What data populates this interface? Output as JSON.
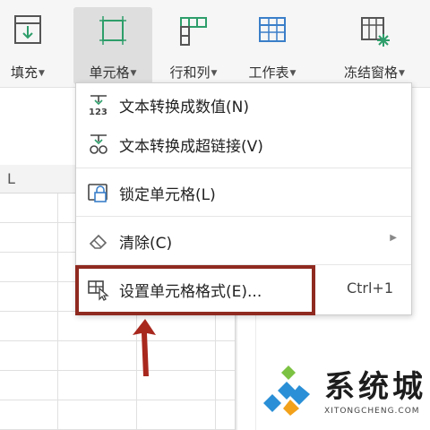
{
  "toolbar": {
    "items": [
      {
        "label": "填充",
        "icon": "fill-down-icon"
      },
      {
        "label": "单元格",
        "icon": "cell-icon",
        "active": true
      },
      {
        "label": "行和列",
        "icon": "rows-columns-icon"
      },
      {
        "label": "工作表",
        "icon": "worksheet-icon"
      },
      {
        "label": "冻结窗格",
        "icon": "freeze-panes-icon"
      }
    ]
  },
  "sheet": {
    "column_label": "L"
  },
  "menu": {
    "items": [
      {
        "label": "文本转换成数值(N)",
        "icon": "text-to-number-icon"
      },
      {
        "label": "文本转换成超链接(V)",
        "icon": "text-to-hyperlink-icon"
      },
      {
        "label": "锁定单元格(L)",
        "icon": "lock-cell-icon"
      },
      {
        "label": "清除(C)",
        "icon": "eraser-icon"
      },
      {
        "label": "设置单元格格式(E)...",
        "shortcut": "Ctrl+1",
        "icon": "format-cells-icon"
      }
    ]
  },
  "colors": {
    "highlight": "#8f2a20",
    "arrow": "#a8281e",
    "accent_green": "#2e9e6b",
    "watermark_blue": "#2a8fd6"
  },
  "watermark": {
    "title": "系统城",
    "subtitle": "XITONGCHENG.COM"
  }
}
